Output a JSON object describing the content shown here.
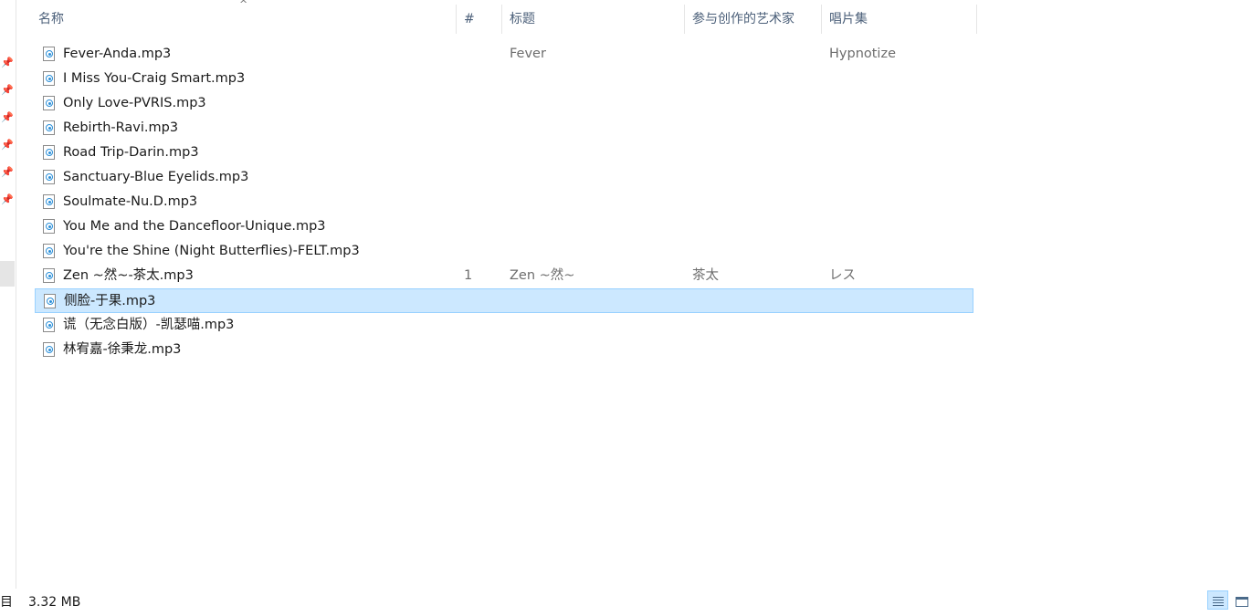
{
  "columns": {
    "name": "名称",
    "track": "#",
    "title": "标题",
    "artists": "参与创作的艺术家",
    "album": "唱片集"
  },
  "files": [
    {
      "name": "Fever-Anda.mp3",
      "track": "",
      "title": "Fever",
      "artist": "",
      "album": "Hypnotize"
    },
    {
      "name": "I Miss You-Craig Smart.mp3",
      "track": "",
      "title": "",
      "artist": "",
      "album": ""
    },
    {
      "name": "Only Love-PVRIS.mp3",
      "track": "",
      "title": "",
      "artist": "",
      "album": ""
    },
    {
      "name": "Rebirth-Ravi.mp3",
      "track": "",
      "title": "",
      "artist": "",
      "album": ""
    },
    {
      "name": "Road Trip-Darin.mp3",
      "track": "",
      "title": "",
      "artist": "",
      "album": ""
    },
    {
      "name": "Sanctuary-Blue Eyelids.mp3",
      "track": "",
      "title": "",
      "artist": "",
      "album": ""
    },
    {
      "name": "Soulmate-Nu.D.mp3",
      "track": "",
      "title": "",
      "artist": "",
      "album": ""
    },
    {
      "name": "You Me and the Dancefloor-Unique.mp3",
      "track": "",
      "title": "",
      "artist": "",
      "album": ""
    },
    {
      "name": "You're the Shine (Night Butterflies)-FELT.mp3",
      "track": "",
      "title": "",
      "artist": "",
      "album": ""
    },
    {
      "name": "Zen ~然~-茶太.mp3",
      "track": "1",
      "title": "Zen ~然~",
      "artist": "茶太",
      "album": "レス"
    },
    {
      "name": "侧脸-于果.mp3",
      "track": "",
      "title": "",
      "artist": "",
      "album": "",
      "selected": true
    },
    {
      "name": "谎（无念白版）-凯瑟喵.mp3",
      "track": "",
      "title": "",
      "artist": "",
      "album": ""
    },
    {
      "name": "林宥嘉-徐秉龙.mp3",
      "track": "",
      "title": "",
      "artist": "",
      "album": ""
    }
  ],
  "status": {
    "count_text": "项目",
    "size_text": "3.32 MB"
  },
  "icons": {
    "file": "audio-file-icon",
    "pin": "pin-icon",
    "sort": "sort-ascending-icon",
    "details_view": "details-view-icon",
    "tiles_view": "large-icons-view-icon"
  },
  "colors": {
    "selection_bg": "#cce8ff",
    "selection_border": "#99d1ff",
    "header_text": "#4c607a",
    "meta_text": "#6d6d6d"
  }
}
